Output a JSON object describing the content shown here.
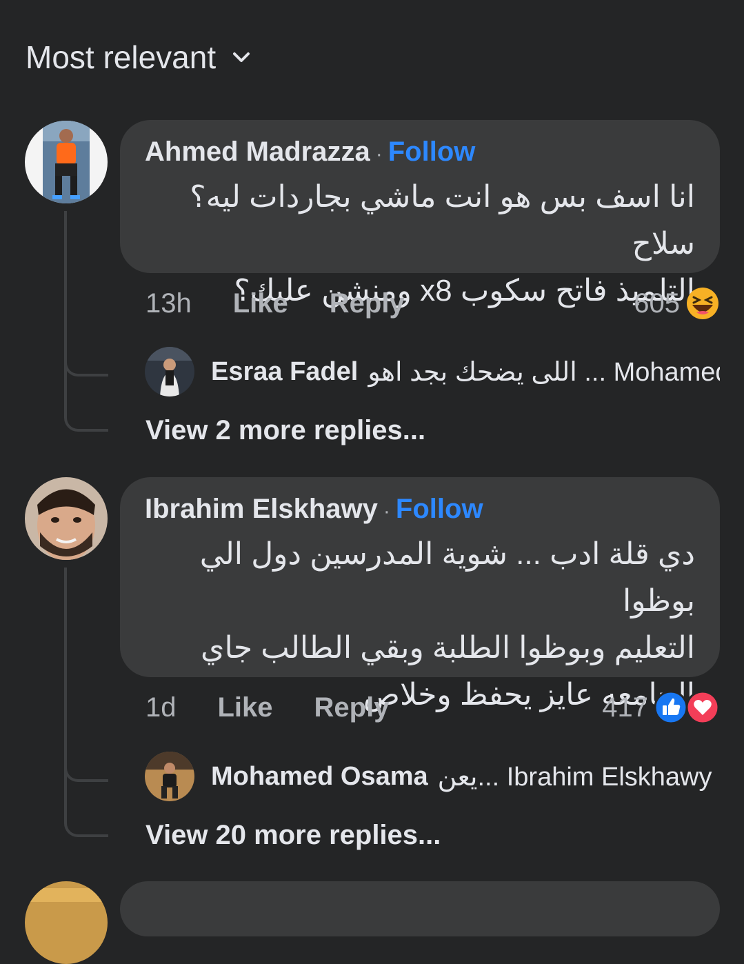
{
  "sort": {
    "label": "Most relevant"
  },
  "comments": [
    {
      "author": "Ahmed Madrazza",
      "separator": "·",
      "follow": "Follow",
      "lines": [
        "انا اسف بس هو انت ماشي بجاردات ليه؟ سلاح",
        "التلميذ فاتح سكوب x8 ومنشن عليك؟"
      ],
      "time": "13h",
      "like": "Like",
      "reply": "Reply",
      "reaction_count": "605",
      "reactions": [
        "haha-icon"
      ],
      "reply_preview": {
        "author": "Esraa Fadel",
        "text": "اللى يضحك بجد اهو ... Mohamed"
      },
      "view_more": "View 2 more replies..."
    },
    {
      "author": "Ibrahim Elskhawy",
      "separator": "·",
      "follow": "Follow",
      "lines": [
        "دي قلة ادب ... شوية المدرسين دول الي بوظوا",
        "التعليم وبوظوا الطلبة وبقي الطالب جاي",
        "الجامعه عايز يحفظ وخلاص"
      ],
      "time": "1d",
      "like": "Like",
      "reply": "Reply",
      "reaction_count": "417",
      "reactions": [
        "like-icon",
        "love-icon"
      ],
      "reply_preview": {
        "author": "Mohamed Osama",
        "text": "يعن... Ibrahim Elskhawy"
      },
      "view_more": "View 20 more replies..."
    }
  ],
  "colors": {
    "background": "#242526",
    "bubble": "#3a3b3c",
    "accent": "#2d88ff",
    "secondary_text": "#b0b3b8"
  }
}
